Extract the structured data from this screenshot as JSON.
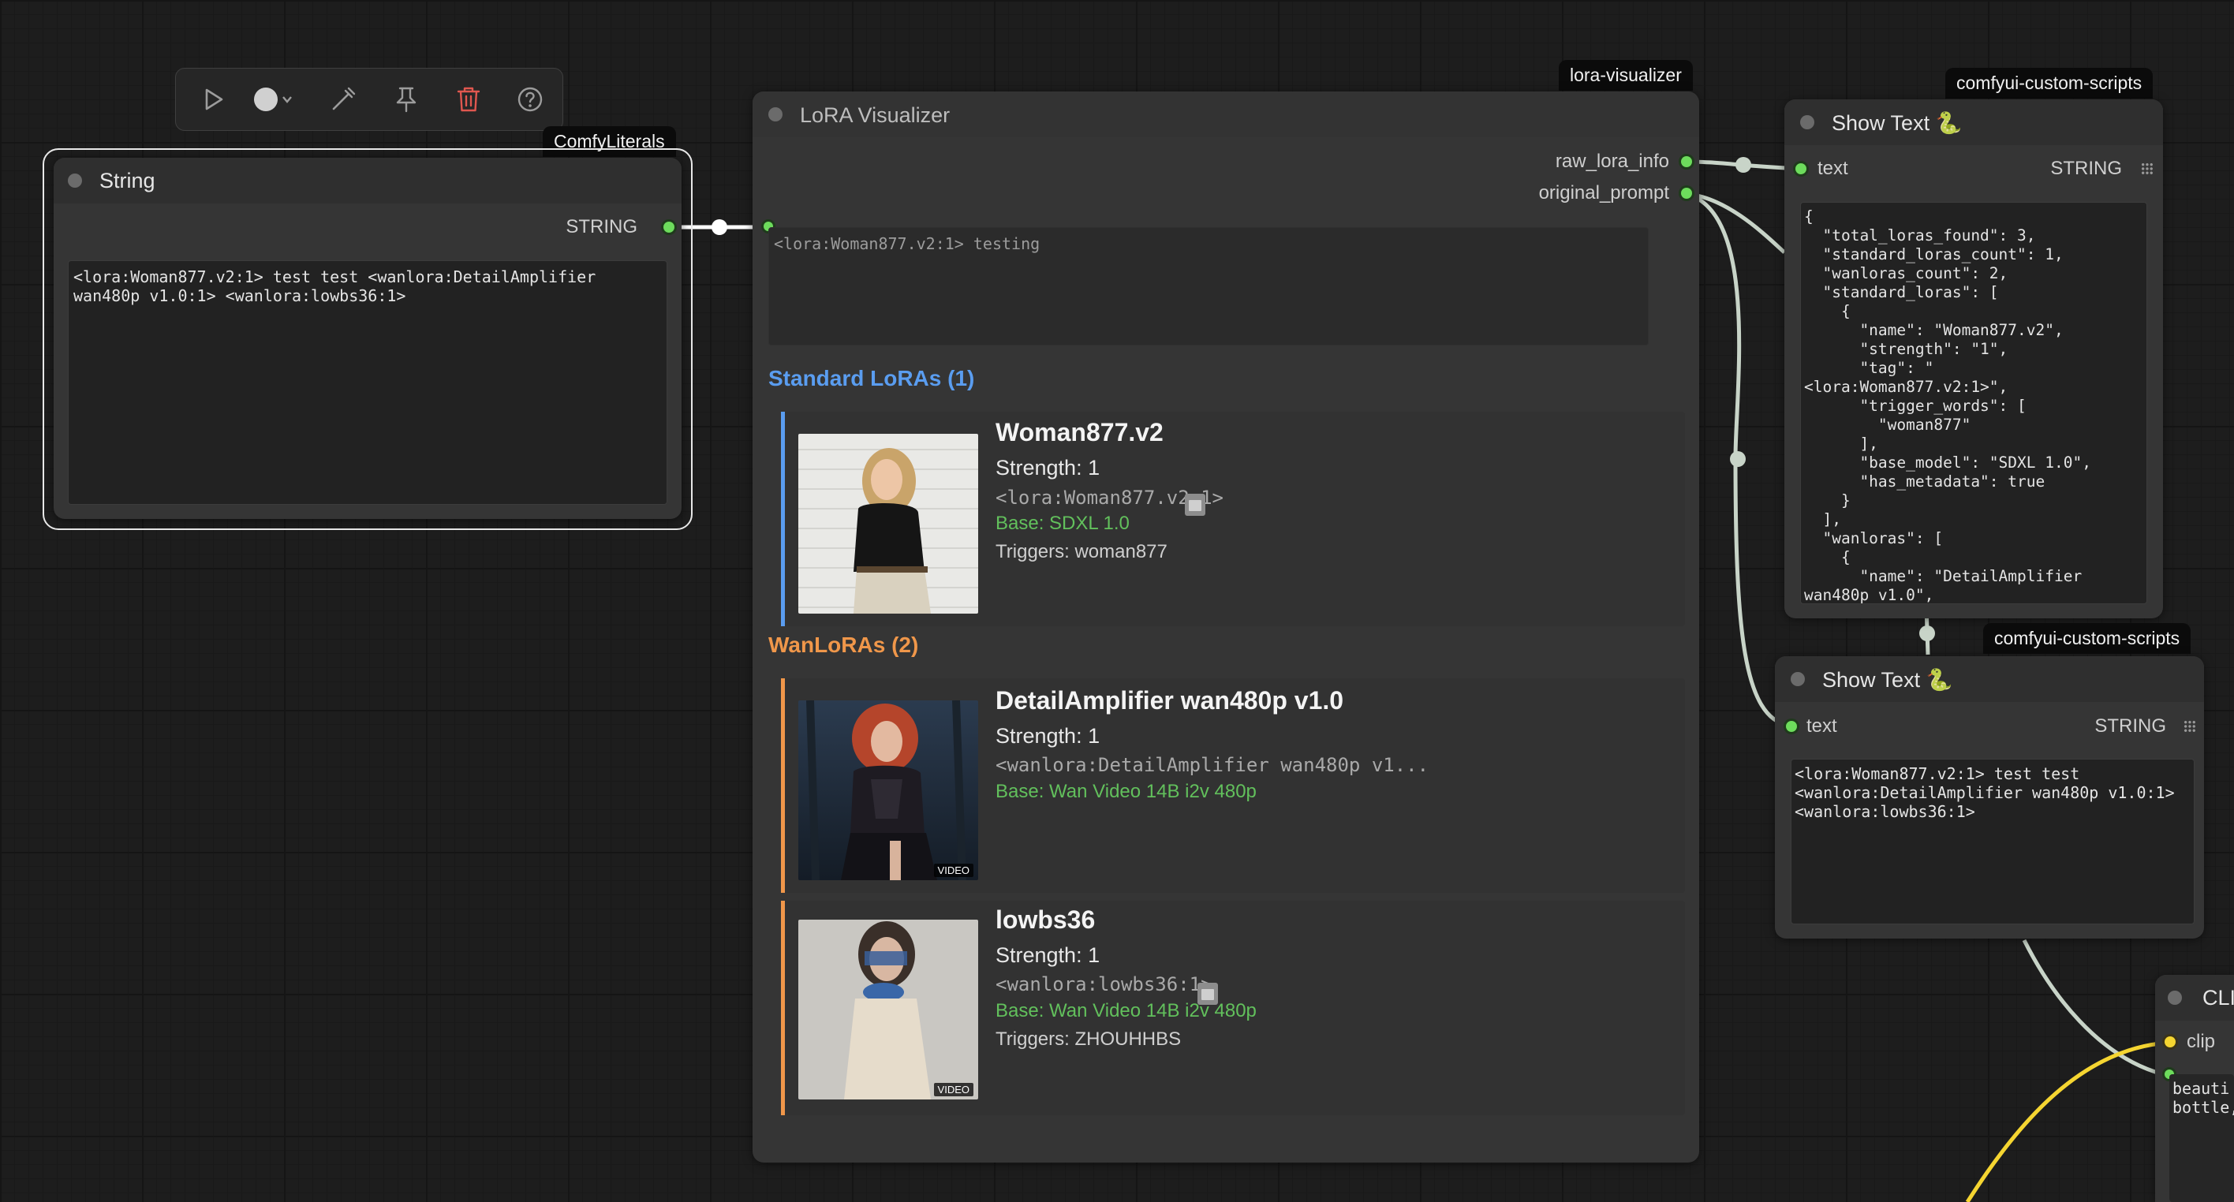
{
  "toolbar": {
    "icons": [
      "play-icon",
      "color-circle-icon",
      "chevron-down-icon",
      "bypass-wand-icon",
      "pin-icon",
      "trash-icon",
      "help-icon"
    ],
    "trash_color": "#e0574f"
  },
  "string_node": {
    "badge": "ComfyLiterals",
    "title": "String",
    "output_label": "STRING",
    "value": "<lora:Woman877.v2:1> test test <wanlora:DetailAmplifier\nwan480p v1.0:1> <wanlora:lowbs36:1>"
  },
  "lora_visualizer": {
    "badge": "lora-visualizer",
    "title": "LoRA Visualizer",
    "outputs": [
      "raw_lora_info",
      "original_prompt"
    ],
    "prompt_preview": "<lora:Woman877.v2:1> testing",
    "standard_section": {
      "title": "Standard LoRAs (1)",
      "color": "#5a9df0",
      "cards": [
        {
          "name": "Woman877.v2",
          "strength": "Strength: 1",
          "tag": "<lora:Woman877.v2:1>",
          "base": "Base: SDXL 1.0",
          "triggers": "Triggers: woman877"
        }
      ]
    },
    "wan_section": {
      "title": "WanLoRAs (2)",
      "color": "#f0974a",
      "cards": [
        {
          "name": "DetailAmplifier wan480p v1.0",
          "strength": "Strength: 1",
          "tag": "<wanlora:DetailAmplifier wan480p v1...",
          "base": "Base: Wan Video 14B i2v 480p",
          "video_badge": "VIDEO"
        },
        {
          "name": "lowbs36",
          "strength": "Strength: 1",
          "tag": "<wanlora:lowbs36:1>",
          "base": "Base: Wan Video 14B i2v 480p",
          "triggers": "Triggers: ZHOUHHBS",
          "video_badge": "VIDEO"
        }
      ]
    }
  },
  "show_text_1": {
    "badge": "comfyui-custom-scripts",
    "title": "Show Text 🐍",
    "input_label": "text",
    "output_label": "STRING",
    "value": "{\n  \"total_loras_found\": 3,\n  \"standard_loras_count\": 1,\n  \"wanloras_count\": 2,\n  \"standard_loras\": [\n    {\n      \"name\": \"Woman877.v2\",\n      \"strength\": \"1\",\n      \"tag\": \"\n<lora:Woman877.v2:1>\",\n      \"trigger_words\": [\n        \"woman877\"\n      ],\n      \"base_model\": \"SDXL 1.0\",\n      \"has_metadata\": true\n    }\n  ],\n  \"wanloras\": [\n    {\n      \"name\": \"DetailAmplifier\nwan480p v1.0\","
  },
  "show_text_2": {
    "badge": "comfyui-custom-scripts",
    "title": "Show Text 🐍",
    "input_label": "text",
    "output_label": "STRING",
    "value": "<lora:Woman877.v2:1> test test\n<wanlora:DetailAmplifier wan480p v1.0:1>\n<wanlora:lowbs36:1>"
  },
  "clip_node": {
    "title": "CLI",
    "input_label": "clip",
    "value": "beauti\nbottle,"
  },
  "colors": {
    "wire_string": "#c8d4c8",
    "wire_clip": "#f5d531",
    "socket_green": "#6ddc5c",
    "socket_yellow": "#f5d531"
  }
}
